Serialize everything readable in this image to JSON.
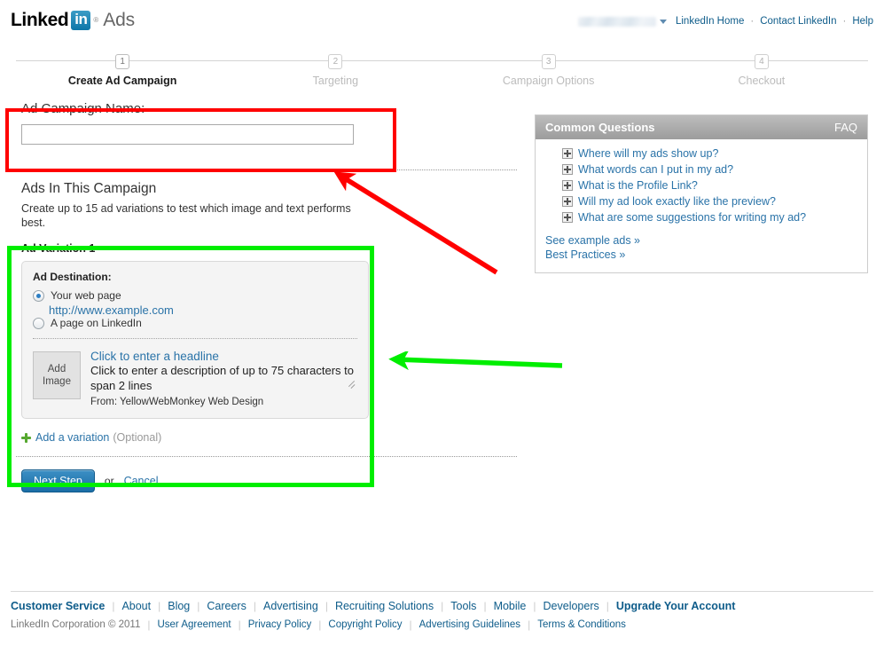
{
  "header": {
    "logo": {
      "linked": "Linked",
      "in": "in",
      "reg": "®",
      "ads": "Ads"
    },
    "username_redacted": "",
    "links": [
      {
        "label": "LinkedIn Home"
      },
      {
        "label": "Contact LinkedIn"
      },
      {
        "label": "Help"
      }
    ],
    "separator": "·"
  },
  "stepper": {
    "steps": [
      {
        "num": "1",
        "label": "Create Ad Campaign",
        "active": true
      },
      {
        "num": "2",
        "label": "Targeting",
        "active": false
      },
      {
        "num": "3",
        "label": "Campaign Options",
        "active": false
      },
      {
        "num": "4",
        "label": "Checkout",
        "active": false
      }
    ]
  },
  "campaign": {
    "name_label": "Ad Campaign Name:",
    "name_value": "",
    "name_placeholder": ""
  },
  "ads_section": {
    "heading": "Ads In This Campaign",
    "description": "Create up to 15 ad variations to test which image and text performs best."
  },
  "variation": {
    "title": "Ad Variation 1",
    "destination_label": "Ad Destination:",
    "options": [
      {
        "label": "Your web page",
        "checked": true
      },
      {
        "label": "A page on LinkedIn",
        "checked": false
      }
    ],
    "url": "http://www.example.com",
    "add_image_line1": "Add",
    "add_image_line2": "Image",
    "headline_placeholder": "Click to enter a headline",
    "description_placeholder": "Click to enter a description of up to 75 characters to span 2 lines",
    "from_text": "From: YellowWebMonkey Web Design"
  },
  "add_variation": {
    "label": "Add a variation",
    "optional": "(Optional)",
    "icon": "plus-icon"
  },
  "actions": {
    "next_label": "Next Step",
    "or_text": "or",
    "cancel_label": "Cancel"
  },
  "faq": {
    "title": "Common Questions",
    "tag": "FAQ",
    "questions": [
      "Where will my ads show up?",
      "What words can I put in my ad?",
      "What is the Profile Link?",
      "Will my ad look exactly like the preview?",
      "What are some suggestions for writing my ad?"
    ],
    "links": [
      "See example ads »",
      "Best Practices »"
    ]
  },
  "footer": {
    "primary": [
      {
        "label": "Customer Service",
        "bold": true
      },
      {
        "label": "About",
        "bold": false
      },
      {
        "label": "Blog",
        "bold": false
      },
      {
        "label": "Careers",
        "bold": false
      },
      {
        "label": "Advertising",
        "bold": false
      },
      {
        "label": "Recruiting Solutions",
        "bold": false
      },
      {
        "label": "Tools",
        "bold": false
      },
      {
        "label": "Mobile",
        "bold": false
      },
      {
        "label": "Developers",
        "bold": false
      },
      {
        "label": "Upgrade Your Account",
        "bold": true
      }
    ],
    "copyright": "LinkedIn Corporation © 2011",
    "secondary": [
      "User Agreement",
      "Privacy Policy",
      "Copyright Policy",
      "Advertising Guidelines",
      "Terms & Conditions"
    ]
  },
  "annotations": {
    "red_color": "#ff0000",
    "green_color": "#00ee00",
    "red_box_target": "Ad Campaign Name",
    "green_box_target": "Ad Variation 1"
  }
}
